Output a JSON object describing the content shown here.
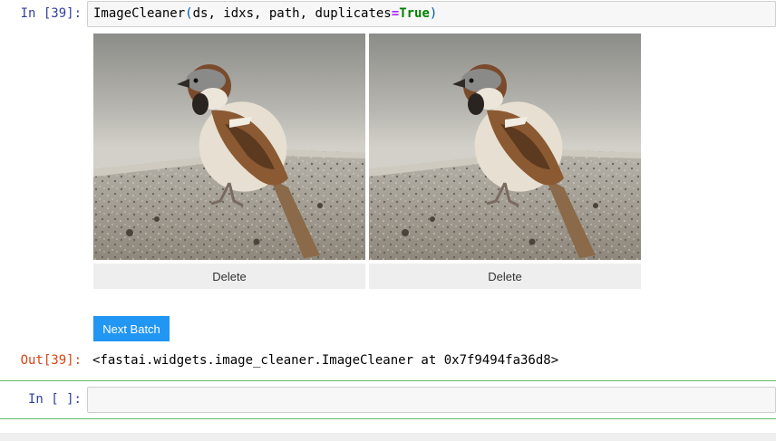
{
  "cell1": {
    "prompt": "In [39]:",
    "code": {
      "func": "ImageCleaner",
      "open": "(",
      "args": "ds, idxs, path, duplicates",
      "eq": "=",
      "kw": "True",
      "close": ")"
    }
  },
  "widget": {
    "images": [
      {
        "icon": "sparrow-photo",
        "delete_label": "Delete"
      },
      {
        "icon": "sparrow-photo",
        "delete_label": "Delete"
      }
    ],
    "next_batch_label": "Next Batch",
    "button_color": "#2196f3"
  },
  "output": {
    "prompt": "Out[39]:",
    "text": "<fastai.widgets.image_cleaner.ImageCleaner at 0x7f9494fa36d8>"
  },
  "cell2": {
    "prompt": "In [ ]:",
    "code": ""
  },
  "colors": {
    "in_prompt": "#303f9f",
    "out_prompt": "#d84315",
    "selected_border": "#66bb6a"
  }
}
